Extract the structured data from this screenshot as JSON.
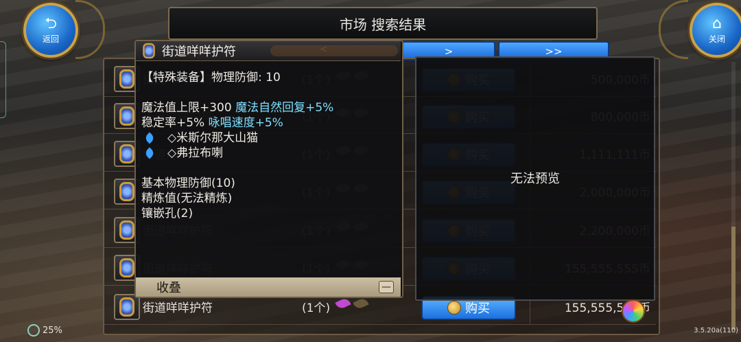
{
  "header": {
    "title": "市场  搜索结果"
  },
  "buttons": {
    "back": "返回",
    "close": "关闭",
    "back_glyph": "⮌",
    "close_glyph": "⌂",
    "next": ">",
    "last": ">>",
    "prev": "<"
  },
  "item_name": "街道咩咩护符",
  "tooltip": {
    "title": "街道咩咩护符",
    "line1": "【特殊装备】物理防御: 10",
    "line2a": "魔法值上限+300",
    "line2b": "魔法自然回复+5%",
    "line3a": "稳定率+5%",
    "line3b": "咏唱速度+5%",
    "card1": "◇米斯尔那大山猫",
    "card2": "◇弗拉布喇",
    "line4": "基本物理防御(10)",
    "line5": "精炼值(无法精炼)",
    "line6": "镶嵌孔(2)",
    "collapse": "收叠",
    "minus": "—"
  },
  "preview": {
    "message": "无法预览"
  },
  "rows": [
    {
      "name": "街道咩咩护符",
      "count": "(1个)",
      "buy": "购买",
      "price": "500,000币"
    },
    {
      "name": "街道咩咩护符",
      "count": "(1个)",
      "buy": "购买",
      "price": "800,000币"
    },
    {
      "name": "街道咩咩护符",
      "count": "(1个)",
      "buy": "购买",
      "price": "1,111,111币"
    },
    {
      "name": "街道咩咩护符",
      "count": "(1个)",
      "buy": "购买",
      "price": "2,000,000币"
    },
    {
      "name": "街道咩咩护符",
      "count": "(1个)",
      "buy": "购买",
      "price": "2,200,000币"
    },
    {
      "name": "街道咩咩护符",
      "count": "(1个)",
      "buy": "购买",
      "price": "155,555,555币"
    },
    {
      "name": "街道咩咩护符",
      "count": "(1个)",
      "buy": "购买",
      "price": "155,555,555币"
    }
  ],
  "status": {
    "battery": "25%",
    "version": "3.5.20a(110)"
  },
  "colors": {
    "accent_blue": "#1b6fe0",
    "gold": "#c9a34b",
    "cyan_text": "#7fe0ff"
  }
}
